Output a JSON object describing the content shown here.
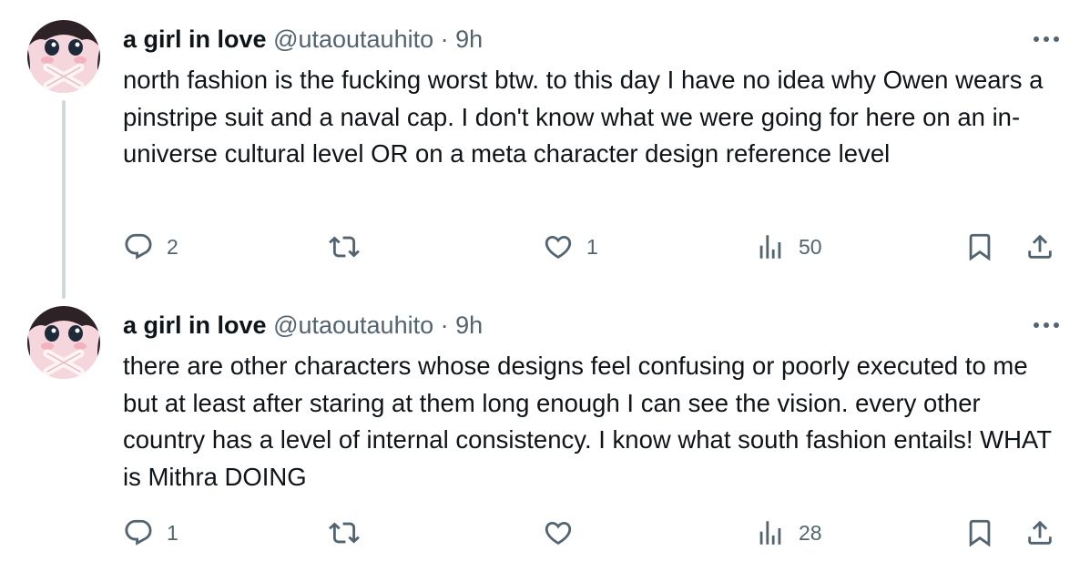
{
  "tweets": [
    {
      "author_name": "a girl in love",
      "author_handle": "@utaoutauhito",
      "separator": "·",
      "time": "9h",
      "text": "north fashion is the fucking worst btw. to this day I have no idea why Owen wears a pinstripe suit and a naval cap. I don't know what we were going for here on an in-universe cultural level OR on a meta character design reference level",
      "replies": "2",
      "retweets": "",
      "likes": "1",
      "views": "50"
    },
    {
      "author_name": "a girl in love",
      "author_handle": "@utaoutauhito",
      "separator": "·",
      "time": "9h",
      "text": "there are other characters whose designs feel confusing or poorly executed to me but at least after staring at them long enough I can see the vision. every other country has a level of internal consistency. I know what south fashion entails! WHAT is Mithra DOING",
      "replies": "1",
      "retweets": "",
      "likes": "",
      "views": "28"
    }
  ],
  "icons": {
    "reply": "reply-icon",
    "retweet": "retweet-icon",
    "like": "heart-icon",
    "views": "views-icon",
    "bookmark": "bookmark-icon",
    "share": "share-icon",
    "more": "more-icon"
  },
  "colors": {
    "text": "#0f1419",
    "secondary": "#536471",
    "thread_line": "#cfd9de"
  }
}
